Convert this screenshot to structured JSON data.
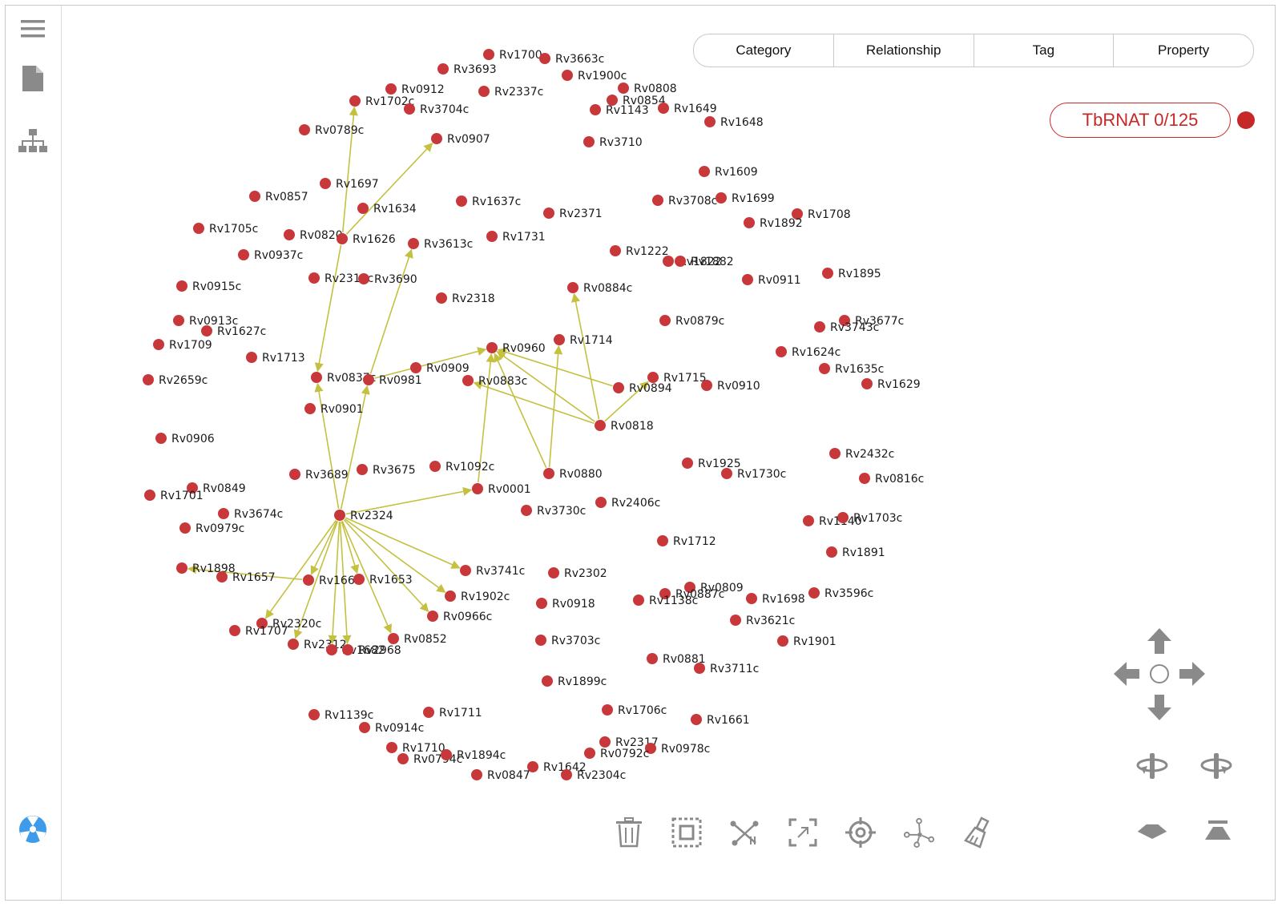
{
  "sidebar": {
    "items": [
      {
        "name": "menu-icon"
      },
      {
        "name": "document-icon"
      },
      {
        "name": "hierarchy-icon"
      }
    ],
    "bottom_icon": "radiation-logo-icon"
  },
  "tabs": [
    {
      "label": "Category"
    },
    {
      "label": "Relationship"
    },
    {
      "label": "Tag"
    },
    {
      "label": "Property"
    }
  ],
  "dataset": {
    "label": "TbRNAT 0/125",
    "color": "#c62828"
  },
  "graph": {
    "node_color": "#c8383a",
    "edge_color": "#c4c040",
    "nodes": [
      {
        "id": "Rv1700"
      },
      {
        "id": "Rv3663c"
      },
      {
        "id": "Rv3693"
      },
      {
        "id": "Rv1900c"
      },
      {
        "id": "Rv0912"
      },
      {
        "id": "Rv2337c"
      },
      {
        "id": "Rv0808"
      },
      {
        "id": "Rv1702c"
      },
      {
        "id": "Rv3704c"
      },
      {
        "id": "Rv0854"
      },
      {
        "id": "Rv1143"
      },
      {
        "id": "Rv1649"
      },
      {
        "id": "Rv1648"
      },
      {
        "id": "Rv0789c"
      },
      {
        "id": "Rv0907"
      },
      {
        "id": "Rv3710"
      },
      {
        "id": "Rv1609"
      },
      {
        "id": "Rv1697"
      },
      {
        "id": "Rv0857"
      },
      {
        "id": "Rv1634"
      },
      {
        "id": "Rv1637c"
      },
      {
        "id": "Rv3708c"
      },
      {
        "id": "Rv1699"
      },
      {
        "id": "Rv2371"
      },
      {
        "id": "Rv1708"
      },
      {
        "id": "Rv1892"
      },
      {
        "id": "Rv1705c"
      },
      {
        "id": "Rv0820"
      },
      {
        "id": "Rv1626"
      },
      {
        "id": "Rv1731"
      },
      {
        "id": "Rv3613c"
      },
      {
        "id": "Rv0937c"
      },
      {
        "id": "Rv1222"
      },
      {
        "id": "Rv1822"
      },
      {
        "id": "Rv1882"
      },
      {
        "id": "Rv1895"
      },
      {
        "id": "Rv2314c"
      },
      {
        "id": "Rv3690"
      },
      {
        "id": "Rv0911"
      },
      {
        "id": "Rv0915c"
      },
      {
        "id": "Rv0884c"
      },
      {
        "id": "Rv2318"
      },
      {
        "id": "Rv0879c"
      },
      {
        "id": "Rv3677c"
      },
      {
        "id": "Rv0913c"
      },
      {
        "id": "Rv3743c"
      },
      {
        "id": "Rv1627c"
      },
      {
        "id": "Rv1709"
      },
      {
        "id": "Rv1714"
      },
      {
        "id": "Rv0960"
      },
      {
        "id": "Rv1624c"
      },
      {
        "id": "Rv1713"
      },
      {
        "id": "Rv1635c"
      },
      {
        "id": "Rv0909"
      },
      {
        "id": "Rv2659c"
      },
      {
        "id": "Rv0837c"
      },
      {
        "id": "Rv0981"
      },
      {
        "id": "Rv0883c"
      },
      {
        "id": "Rv1715"
      },
      {
        "id": "Rv0894"
      },
      {
        "id": "Rv0910"
      },
      {
        "id": "Rv1629"
      },
      {
        "id": "Rv0901"
      },
      {
        "id": "Rv0818"
      },
      {
        "id": "Rv0906"
      },
      {
        "id": "Rv2432c"
      },
      {
        "id": "Rv1925"
      },
      {
        "id": "Rv1092c"
      },
      {
        "id": "Rv3689"
      },
      {
        "id": "Rv3675"
      },
      {
        "id": "Rv0880"
      },
      {
        "id": "Rv1730c"
      },
      {
        "id": "Rv0816c"
      },
      {
        "id": "Rv0849"
      },
      {
        "id": "Rv0001"
      },
      {
        "id": "Rv1701"
      },
      {
        "id": "Rv3674c"
      },
      {
        "id": "Rv2324"
      },
      {
        "id": "Rv3730c"
      },
      {
        "id": "Rv2406c"
      },
      {
        "id": "Rv1140"
      },
      {
        "id": "Rv1703c"
      },
      {
        "id": "Rv0979c"
      },
      {
        "id": "Rv1712"
      },
      {
        "id": "Rv1891"
      },
      {
        "id": "Rv1898"
      },
      {
        "id": "Rv3741c"
      },
      {
        "id": "Rv2302"
      },
      {
        "id": "Rv1657"
      },
      {
        "id": "Rv1660"
      },
      {
        "id": "Rv1653"
      },
      {
        "id": "Rv0809"
      },
      {
        "id": "Rv0887c"
      },
      {
        "id": "Rv1698"
      },
      {
        "id": "Rv3596c"
      },
      {
        "id": "Rv1902c"
      },
      {
        "id": "Rv1138c"
      },
      {
        "id": "Rv0918"
      },
      {
        "id": "Rv2320c"
      },
      {
        "id": "Rv0966c"
      },
      {
        "id": "Rv3621c"
      },
      {
        "id": "Rv1707"
      },
      {
        "id": "Rv0852"
      },
      {
        "id": "Rv3703c"
      },
      {
        "id": "Rv1901"
      },
      {
        "id": "Rv2312"
      },
      {
        "id": "Rv1682"
      },
      {
        "id": "Rv2968"
      },
      {
        "id": "Rv0881"
      },
      {
        "id": "Rv3711c"
      },
      {
        "id": "Rv1899c"
      },
      {
        "id": "Rv1706c"
      },
      {
        "id": "Rv1139c"
      },
      {
        "id": "Rv1711"
      },
      {
        "id": "Rv1661"
      },
      {
        "id": "Rv0914c"
      },
      {
        "id": "Rv2317"
      },
      {
        "id": "Rv0978c"
      },
      {
        "id": "Rv1710"
      },
      {
        "id": "Rv0792c"
      },
      {
        "id": "Rv0794c"
      },
      {
        "id": "Rv1894c"
      },
      {
        "id": "Rv1642"
      },
      {
        "id": "Rv0847"
      },
      {
        "id": "Rv2304c"
      }
    ],
    "edges": [
      [
        "Rv1626",
        "Rv1702c"
      ],
      [
        "Rv1626",
        "Rv0907"
      ],
      [
        "Rv1626",
        "Rv0837c"
      ],
      [
        "Rv0981",
        "Rv3613c"
      ],
      [
        "Rv0981",
        "Rv0960"
      ],
      [
        "Rv2324",
        "Rv0837c"
      ],
      [
        "Rv2324",
        "Rv0981"
      ],
      [
        "Rv2324",
        "Rv0001"
      ],
      [
        "Rv0001",
        "Rv0960"
      ],
      [
        "Rv0880",
        "Rv0960"
      ],
      [
        "Rv0880",
        "Rv1714"
      ],
      [
        "Rv0818",
        "Rv0960"
      ],
      [
        "Rv0818",
        "Rv0883c"
      ],
      [
        "Rv0818",
        "Rv0884c"
      ],
      [
        "Rv0894",
        "Rv0960"
      ],
      [
        "Rv0818",
        "Rv1715"
      ],
      [
        "Rv2324",
        "Rv3741c"
      ],
      [
        "Rv2324",
        "Rv1902c"
      ],
      [
        "Rv2324",
        "Rv0966c"
      ],
      [
        "Rv2324",
        "Rv0852"
      ],
      [
        "Rv2324",
        "Rv2968"
      ],
      [
        "Rv2324",
        "Rv1682"
      ],
      [
        "Rv2324",
        "Rv2312"
      ],
      [
        "Rv2324",
        "Rv2320c"
      ],
      [
        "Rv2324",
        "Rv1653"
      ],
      [
        "Rv2324",
        "Rv1660"
      ],
      [
        "Rv1660",
        "Rv1898"
      ]
    ]
  },
  "toolbar": {
    "tools": [
      {
        "name": "delete-icon"
      },
      {
        "name": "select-area-icon"
      },
      {
        "name": "expand-edges-icon"
      },
      {
        "name": "fit-frame-icon"
      },
      {
        "name": "target-icon"
      },
      {
        "name": "layout-network-icon"
      },
      {
        "name": "clear-brush-icon"
      }
    ]
  },
  "navigation": {
    "controls": [
      {
        "name": "pan-up-icon"
      },
      {
        "name": "pan-left-icon"
      },
      {
        "name": "center-icon"
      },
      {
        "name": "pan-right-icon"
      },
      {
        "name": "pan-down-icon"
      },
      {
        "name": "rotate-left-icon"
      },
      {
        "name": "rotate-right-icon"
      },
      {
        "name": "tilt-down-icon"
      },
      {
        "name": "tilt-up-icon"
      }
    ]
  }
}
